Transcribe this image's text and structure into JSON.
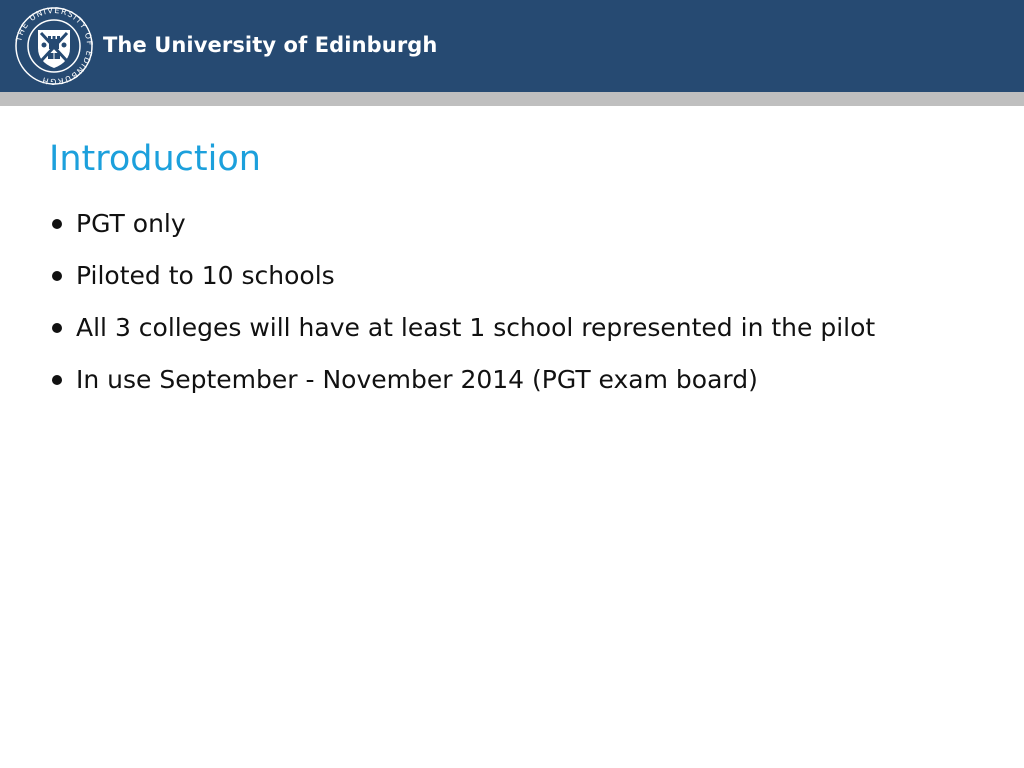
{
  "header": {
    "university_name": "The University of Edinburgh",
    "crest_text": "THE UNIVERSITY OF EDINBURGH",
    "bar_color": "#264a72",
    "stripe_color": "#bfbfbf"
  },
  "slide": {
    "title": "Introduction",
    "title_color": "#1ca0dc",
    "bullets": [
      "PGT only",
      "Piloted to 10 schools",
      "All 3 colleges will have at least 1 school represented in the pilot",
      "In use September - November 2014 (PGT exam board)"
    ]
  }
}
